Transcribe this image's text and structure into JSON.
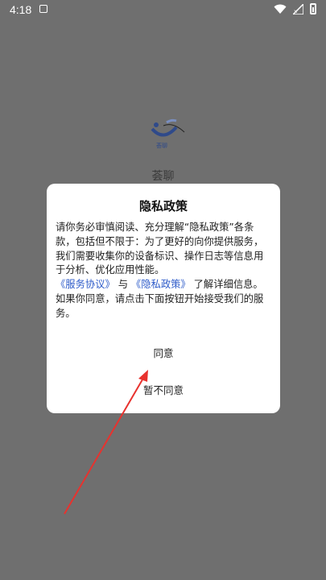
{
  "status_bar": {
    "time": "4:18",
    "icons": [
      "notification-icon",
      "wifi-icon",
      "signal-icon",
      "battery-icon"
    ]
  },
  "splash": {
    "app_name": "荟聊",
    "logo_text": "荟聊"
  },
  "dialog": {
    "title": "隐私政策",
    "body_text_1": "请你务必审慎阅读、充分理解“隐私政策”各条款，包括但不限于：为了更好的向你提供服务，我们需要收集你的设备标识、操作日志等信息用于分析、优化应用性能。",
    "link_service": "《服务协议》",
    "connector": " 与 ",
    "link_privacy": "《隐私政策》",
    "body_text_2": " 了解详细信息。",
    "body_text_3": "如果你同意，请点击下面按钮开始接受我们的服务。",
    "agree_label": "同意",
    "disagree_label": "暂不同意"
  },
  "colors": {
    "overlay": "#6f6f6f",
    "link": "#2d5bc9",
    "arrow": "#e8322e"
  }
}
